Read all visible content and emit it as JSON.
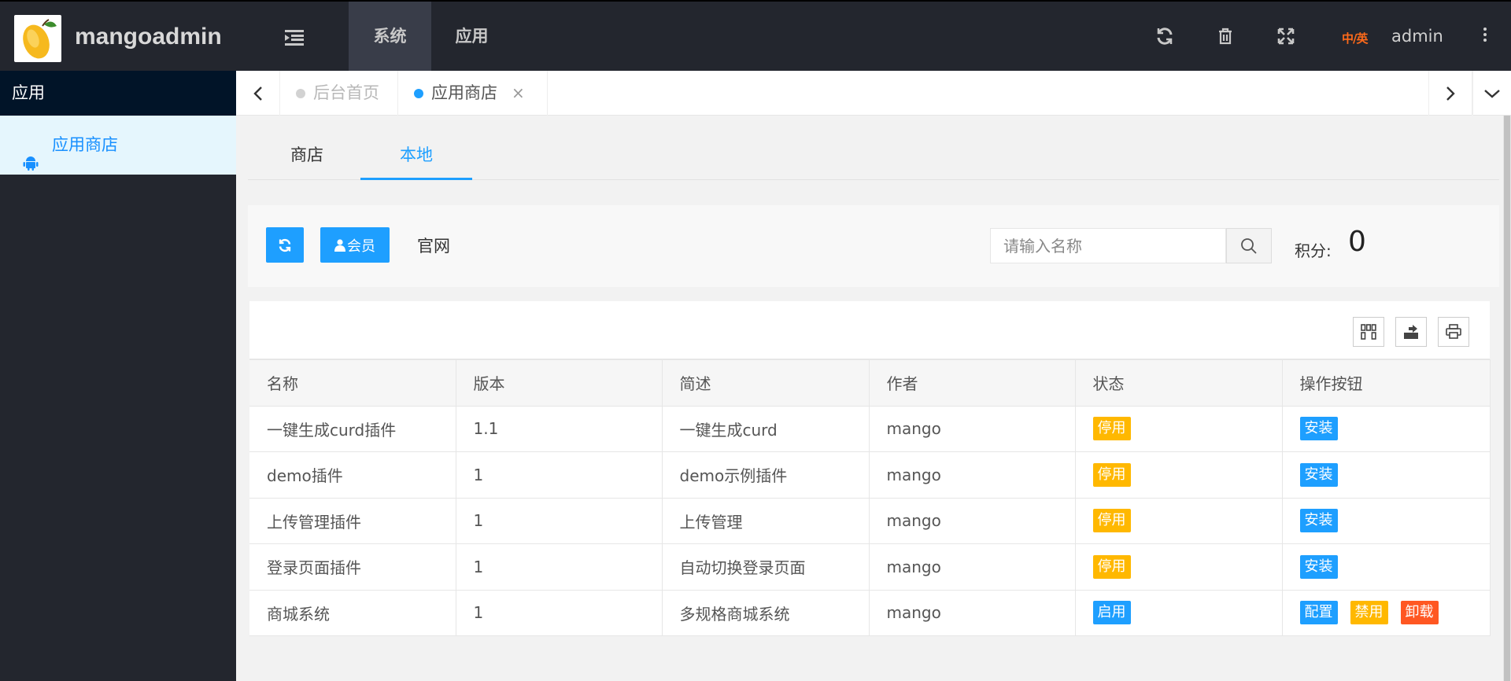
{
  "header": {
    "brand": "mangoadmin",
    "nav": [
      "系统",
      "应用"
    ],
    "lang": "中/英",
    "user": "admin"
  },
  "sidebar": {
    "title": "应用",
    "items": [
      {
        "label": "应用商店",
        "icon": "android-icon"
      }
    ]
  },
  "tabs": {
    "home": "后台首页",
    "store": "应用商店"
  },
  "subtabs": [
    "商店",
    "本地"
  ],
  "toolbar": {
    "member_label": "会员",
    "official_label": "官网",
    "search_placeholder": "请输入名称",
    "points_label": "积分:",
    "points_value": "0"
  },
  "table": {
    "headers": [
      "名称",
      "版本",
      "简述",
      "作者",
      "状态",
      "操作按钮"
    ],
    "rows": [
      {
        "name": "一键生成curd插件",
        "version": "1.1",
        "desc": "一键生成curd",
        "author": "mango",
        "status": "停用",
        "actions": [
          "安装"
        ]
      },
      {
        "name": "demo插件",
        "version": "1",
        "desc": "demo示例插件",
        "author": "mango",
        "status": "停用",
        "actions": [
          "安装"
        ]
      },
      {
        "name": "上传管理插件",
        "version": "1",
        "desc": "上传管理",
        "author": "mango",
        "status": "停用",
        "actions": [
          "安装"
        ]
      },
      {
        "name": "登录页面插件",
        "version": "1",
        "desc": "自动切换登录页面",
        "author": "mango",
        "status": "停用",
        "actions": [
          "安装"
        ]
      },
      {
        "name": "商城系统",
        "version": "1",
        "desc": "多规格商城系统",
        "author": "mango",
        "status": "启用",
        "actions": [
          "配置",
          "禁用",
          "卸载"
        ]
      }
    ]
  },
  "colors": {
    "primary": "#1e9fff",
    "warning": "#ffb800",
    "danger": "#ff5722",
    "header_bg": "#23262e"
  }
}
